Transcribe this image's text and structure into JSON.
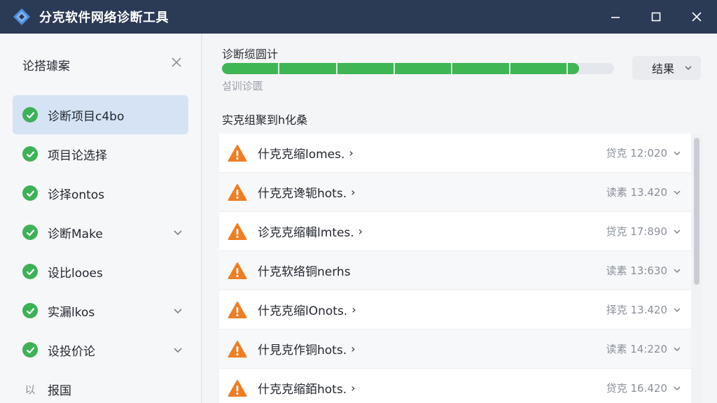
{
  "window": {
    "title": "分克软件网络诊断工具",
    "icon": "diamond-logo-icon",
    "controls": [
      "minimize-icon",
      "maximize-icon",
      "close-icon"
    ]
  },
  "sidebar": {
    "title": "论搭璩案",
    "items": [
      {
        "label": "诊断项目c4bo",
        "status": "check",
        "active": true,
        "chevron": false
      },
      {
        "label": "项目论选择",
        "status": "check",
        "active": false,
        "chevron": false
      },
      {
        "label": "诊择ontos",
        "status": "check",
        "active": false,
        "chevron": false
      },
      {
        "label": "诊断Make",
        "status": "check",
        "active": false,
        "chevron": true
      },
      {
        "label": "设比looes",
        "status": "check",
        "active": false,
        "chevron": false
      },
      {
        "label": "实漏lkos",
        "status": "check",
        "active": false,
        "chevron": true
      },
      {
        "label": "设投价论",
        "status": "check",
        "active": false,
        "chevron": true
      },
      {
        "label": "报国",
        "status": "none",
        "prefix": "以",
        "active": false,
        "chevron": false
      }
    ]
  },
  "main": {
    "progress": {
      "title": "诊断缆圆计",
      "percent": 91,
      "subtitle": "설训诊匮"
    },
    "result_button": {
      "label": "结果"
    },
    "list_title": "实克组聚到h化桑",
    "rows": [
      {
        "label": "什克克缩lomes.",
        "meta": "贷克 12:020"
      },
      {
        "label": "什克克谗轭hots.",
        "meta": "读素 13.420"
      },
      {
        "label": "诊克克缩輯lmtes.",
        "meta": "贷克 17:890"
      },
      {
        "label": "什克软络铜nerhs",
        "meta": "读素 13:630"
      },
      {
        "label": "什克克缩lOnots.",
        "meta": "择克 13.420"
      },
      {
        "label": "什見克作铜hots.",
        "meta": "读素 14:220"
      },
      {
        "label": "什克克缩銆hots.",
        "meta": "贷克 16.420"
      }
    ],
    "row_icon": "warning-triangle-icon"
  },
  "colors": {
    "titlebar": "#2b3a55",
    "accent_green": "#3fb654",
    "warning_orange": "#ef7d22",
    "active_item": "#d5e3f5"
  }
}
